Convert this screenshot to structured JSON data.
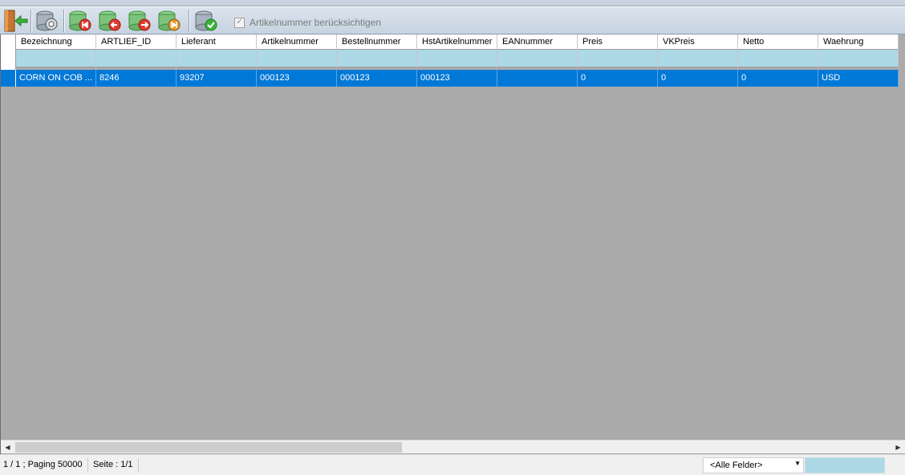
{
  "toolbar": {
    "buttons": [
      {
        "name": "exit-door-icon"
      },
      {
        "name": "settings-database-icon"
      },
      {
        "name": "first-record-database-icon"
      },
      {
        "name": "previous-record-database-icon"
      },
      {
        "name": "next-record-database-icon"
      },
      {
        "name": "last-record-database-icon"
      },
      {
        "name": "apply-database-icon"
      }
    ],
    "checkbox_label": "Artikelnummer berücksichtigen",
    "checkbox_mark": "✓"
  },
  "grid": {
    "columns": [
      "Bezeichnung",
      "ARTLIEF_ID",
      "Lieferant",
      "Artikelnummer",
      "Bestellnummer",
      "HstArtikelnummer",
      "EANnummer",
      "Preis",
      "VKPreis",
      "Netto",
      "Waehrung"
    ],
    "rows": [
      [
        "CORN ON COB ...",
        "8246",
        "93207",
        "000123",
        "000123",
        "000123",
        "",
        "0",
        "0",
        "0",
        "USD"
      ]
    ],
    "selection_color": "#0078d7",
    "filter_color": "#add8e6"
  },
  "status": {
    "paging": "1 / 1 ; Paging 50000",
    "page": "Seite : 1/1",
    "field_filter": "<Alle Felder>"
  }
}
